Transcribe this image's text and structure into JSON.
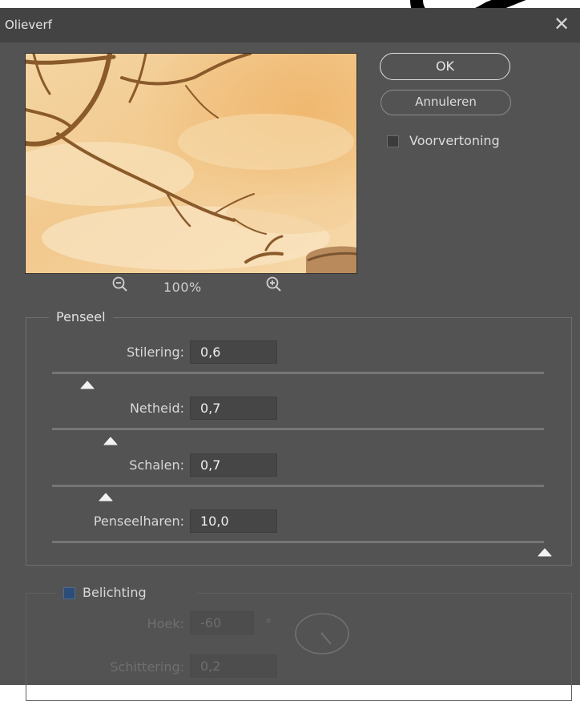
{
  "dialog": {
    "title": "Olieverf",
    "close_symbol": "✕"
  },
  "preview": {
    "zoom_level": "100%",
    "zoom_out_icon": "zoom-out-magnifier",
    "zoom_in_icon": "zoom-in-magnifier"
  },
  "buttons": {
    "ok": "OK",
    "cancel": "Annuleren"
  },
  "preview_toggle": {
    "label": "Voorvertoning",
    "checked": false
  },
  "brush": {
    "legend": "Penseel",
    "params": [
      {
        "label": "Stilering:",
        "value": "0,6",
        "level": 0.02
      },
      {
        "label": "Netheid:",
        "value": "0,7",
        "level": 0.07
      },
      {
        "label": "Schalen:",
        "value": "0,7",
        "level": 0.06
      },
      {
        "label": "Penseelharen:",
        "value": "10,0",
        "level": 1.0
      }
    ]
  },
  "lighting": {
    "legend": "Belichting",
    "checked": true,
    "angle_label": "Hoek:",
    "angle_value": "-60",
    "degree_symbol": "°",
    "shine_label": "Schittering:",
    "shine_value": "0,2"
  },
  "colors": {
    "dialog_bg": "#535353",
    "titlebar_bg": "#434343",
    "field_bg": "#464646",
    "accent_checkbox": "#2c4d77"
  }
}
